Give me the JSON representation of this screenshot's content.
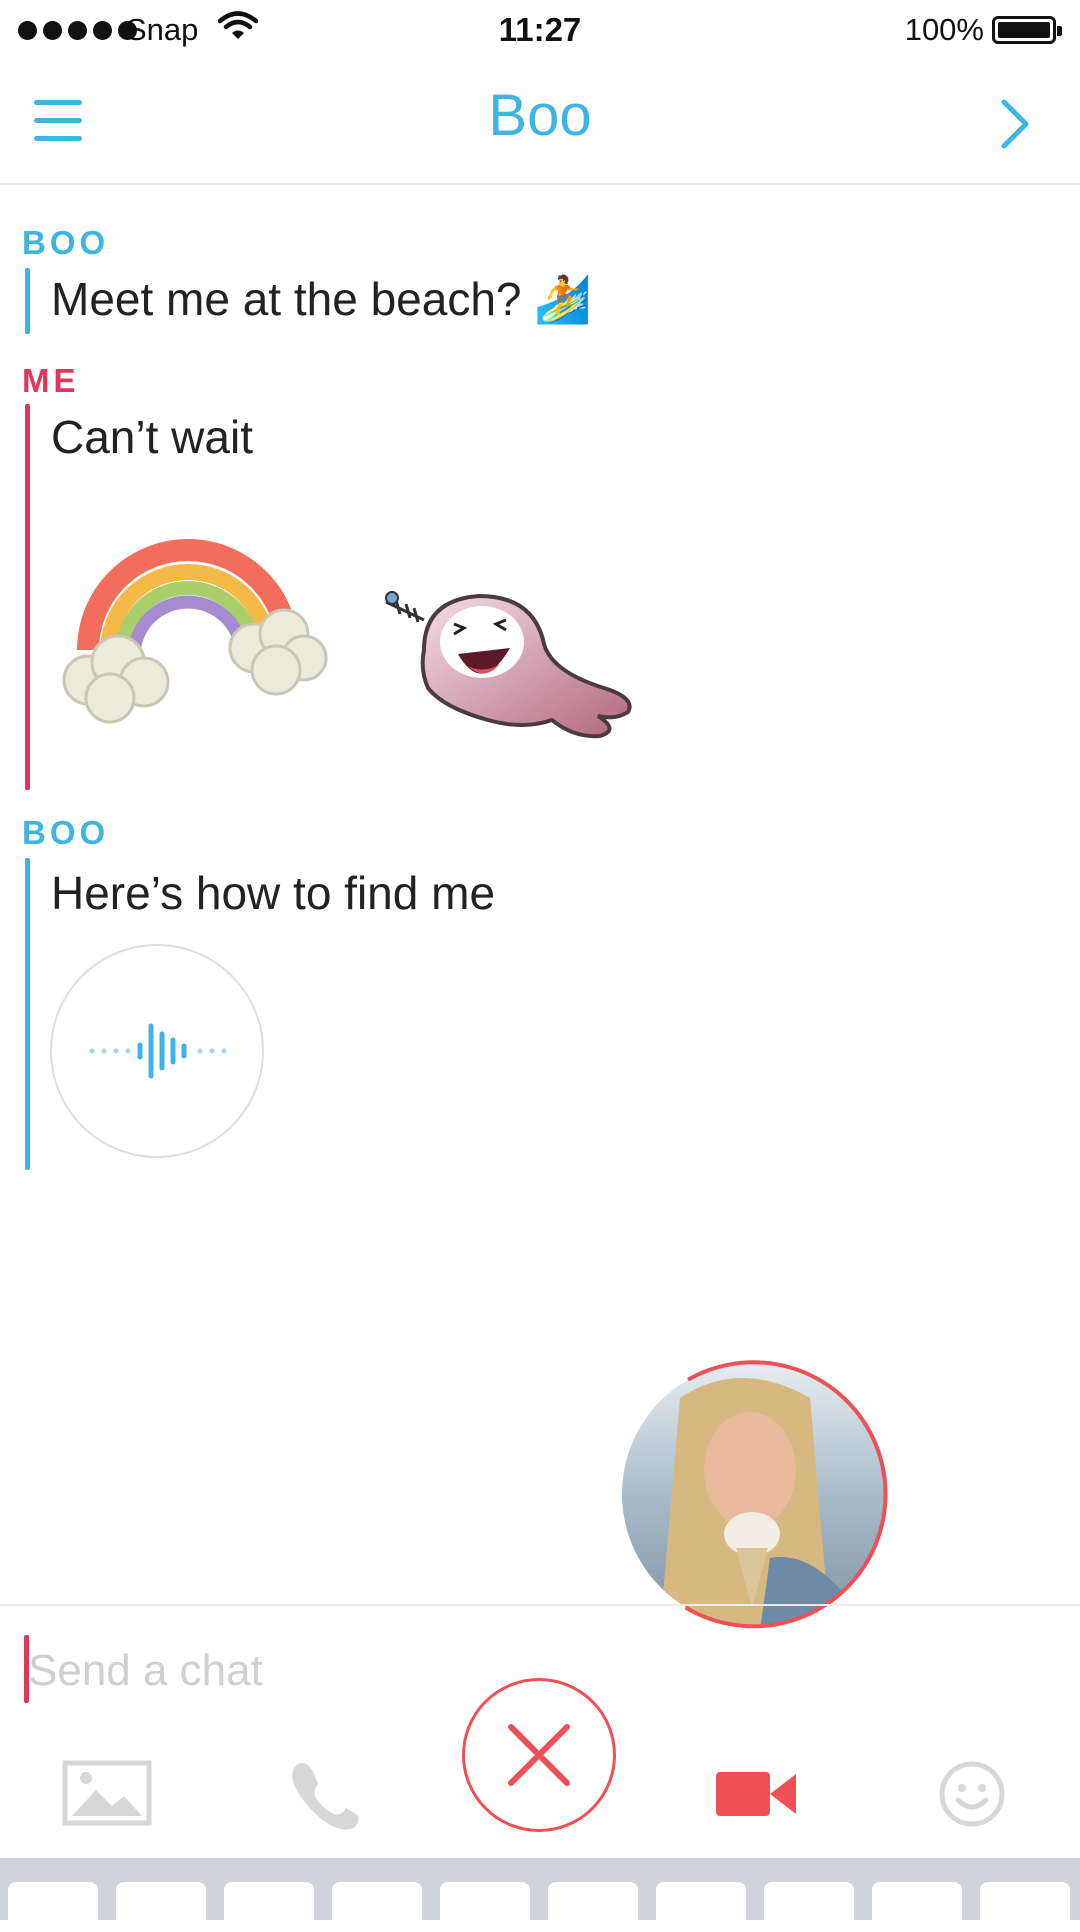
{
  "status_bar": {
    "carrier": "Snap",
    "time": "11:27",
    "battery_percent": "100%",
    "signal_bars": 5,
    "battery_level": 1.0
  },
  "header": {
    "title": "Boo"
  },
  "messages": [
    {
      "sender": "BOO",
      "text": "Meet me at the beach? 🏄"
    },
    {
      "sender": "ME",
      "text": "Can’t wait"
    },
    {
      "sender": "BOO",
      "text": "Here’s how to find me"
    }
  ],
  "input": {
    "placeholder": "Send a chat",
    "value": ""
  },
  "toolbar": {
    "icons": [
      "image-icon",
      "phone-icon",
      "close-icon",
      "video-camera-icon",
      "smiley-icon"
    ]
  },
  "colors": {
    "boo_accent": "#3eb4e2",
    "me_accent": "#e0365c",
    "record_red": "#ef5055"
  }
}
